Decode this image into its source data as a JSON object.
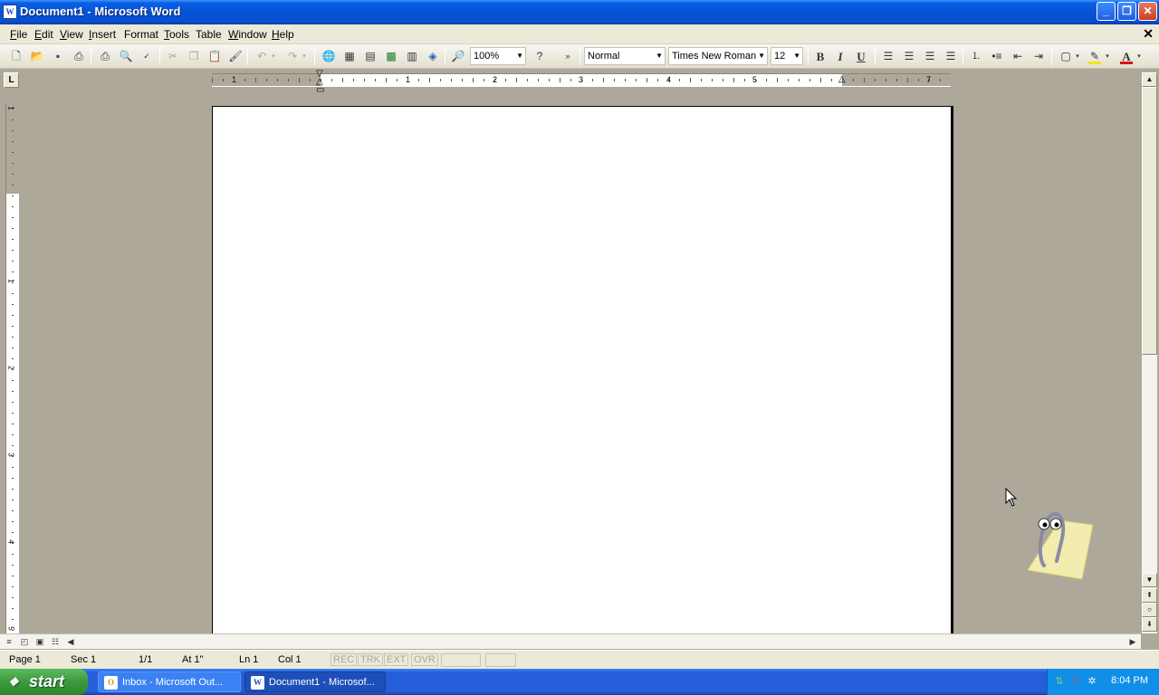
{
  "window": {
    "title": "Document1 - Microsoft Word",
    "icon": "word-doc-icon"
  },
  "menu": {
    "items": [
      {
        "key": "F",
        "rest": "ile"
      },
      {
        "key": "E",
        "rest": "dit"
      },
      {
        "key": "V",
        "rest": "iew"
      },
      {
        "key": "I",
        "rest": "nsert"
      },
      {
        "key": "",
        "rest": "Format"
      },
      {
        "key": "T",
        "rest": "ools"
      },
      {
        "key": "",
        "rest": "Table"
      },
      {
        "key": "W",
        "rest": "indow"
      },
      {
        "key": "H",
        "rest": "elp"
      }
    ]
  },
  "toolbar": {
    "zoom": "100%",
    "style": "Normal",
    "font": "Times New Roman",
    "size": "12",
    "bold": "B",
    "italic": "I",
    "underline": "U",
    "font_color": "#e01010",
    "highlight_color": "#f5e31a"
  },
  "ruler": {
    "numbers": [
      "1",
      "1",
      "2",
      "3",
      "4",
      "5",
      "7"
    ],
    "vertical_numbers": [
      "1",
      "1",
      "2",
      "3",
      "4",
      "5"
    ]
  },
  "status": {
    "page": "Page 1",
    "sec": "Sec 1",
    "pages": "1/1",
    "at": "At 1\"",
    "ln": "Ln 1",
    "col": "Col 1",
    "rec": "REC",
    "trk": "TRK",
    "ext": "EXT",
    "ovr": "OVR"
  },
  "taskbar": {
    "start": "start",
    "tasks": [
      {
        "label": "Inbox - Microsoft Out...",
        "active": false
      },
      {
        "label": "Document1 - Microsof...",
        "active": true
      }
    ],
    "clock": "8:04 PM"
  },
  "colors": {
    "titlebar": "#0553d6",
    "taskbar": "#245edb",
    "start": "#3c9a3c",
    "workspace": "#ada89a"
  }
}
